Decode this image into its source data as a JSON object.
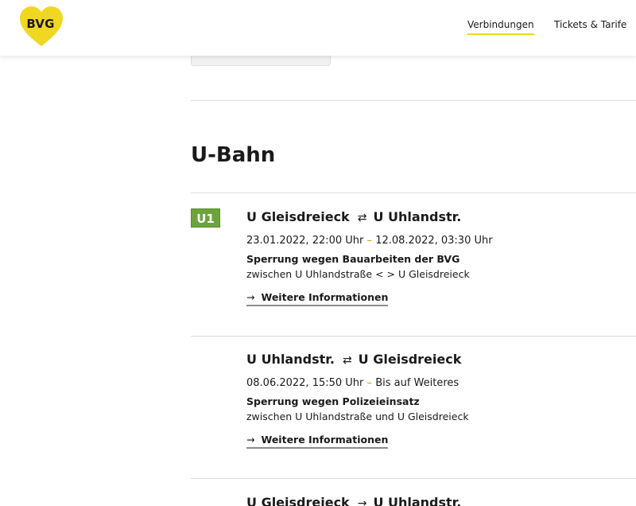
{
  "header": {
    "logo_text": "BVG",
    "brand_color": "#f0d722",
    "nav": [
      {
        "label": "Verbindungen",
        "active": true
      },
      {
        "label": "Tickets & Tarife",
        "active": false
      }
    ]
  },
  "section": {
    "title": "U-Bahn",
    "line": {
      "label": "U1",
      "color": "#6da33c"
    },
    "disruptions": [
      {
        "from": "U Gleisdreieck",
        "to": "U Uhlandstr.",
        "time_start": "23.01.2022, 22:00 Uhr",
        "time_end": "12.08.2022, 03:30 Uhr",
        "reason": "Sperrung wegen Bauarbeiten der BVG",
        "between": "zwischen U Uhlandstraße < > U Gleisdreieck",
        "link": "Weitere Informationen"
      },
      {
        "from": "U Uhlandstr.",
        "to": "U Gleisdreieck",
        "time_start": "08.06.2022, 15:50 Uhr",
        "time_end": "Bis auf Weiteres",
        "reason": "Sperrung wegen Polizeieinsatz",
        "between": "zwischen U Uhlandstraße und U Gleisdreieck",
        "link": "Weitere Informationen"
      },
      {
        "from": "U Gleisdreieck",
        "to": "U Uhlandstr."
      }
    ]
  }
}
